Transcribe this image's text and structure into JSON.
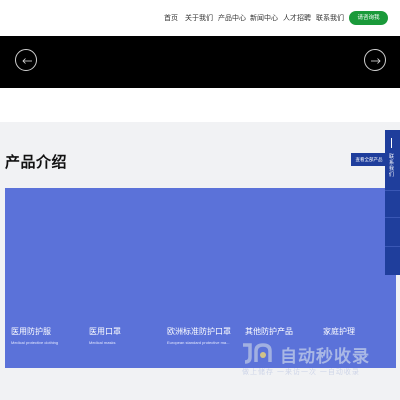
{
  "nav": {
    "items": [
      {
        "label": "首页"
      },
      {
        "label": "关于我们"
      },
      {
        "label": "产品中心"
      },
      {
        "label": "新闻中心"
      },
      {
        "label": "人才招聘"
      },
      {
        "label": "联系我们"
      }
    ],
    "consult_label": "请咨询我"
  },
  "banner": {
    "background": "#000000",
    "prev_icon": "arrow-left-icon",
    "next_icon": "arrow-right-icon"
  },
  "products": {
    "title": "产品介绍",
    "view_all_label": "查看全部产品",
    "panel_color": "#5b72d9",
    "items": [
      {
        "cn": "医用防护服",
        "en": "Medical protective clothing"
      },
      {
        "cn": "医用口罩",
        "en": "Medical masks"
      },
      {
        "cn": "欧洲标准防护口罩",
        "en": "European standard protective ma..."
      },
      {
        "cn": "其他防护产品",
        "en": ""
      },
      {
        "cn": "家庭护理",
        "en": ""
      }
    ]
  },
  "float_bar": {
    "contact_label": "联系我们",
    "color": "#1f3e9c"
  },
  "watermark": {
    "title": "自动秒收录",
    "subtitle": "做上储存 一来访一次 一自动收录"
  },
  "colors": {
    "accent_green": "#1a9a3a",
    "brand_blue": "#1f3e9c"
  }
}
